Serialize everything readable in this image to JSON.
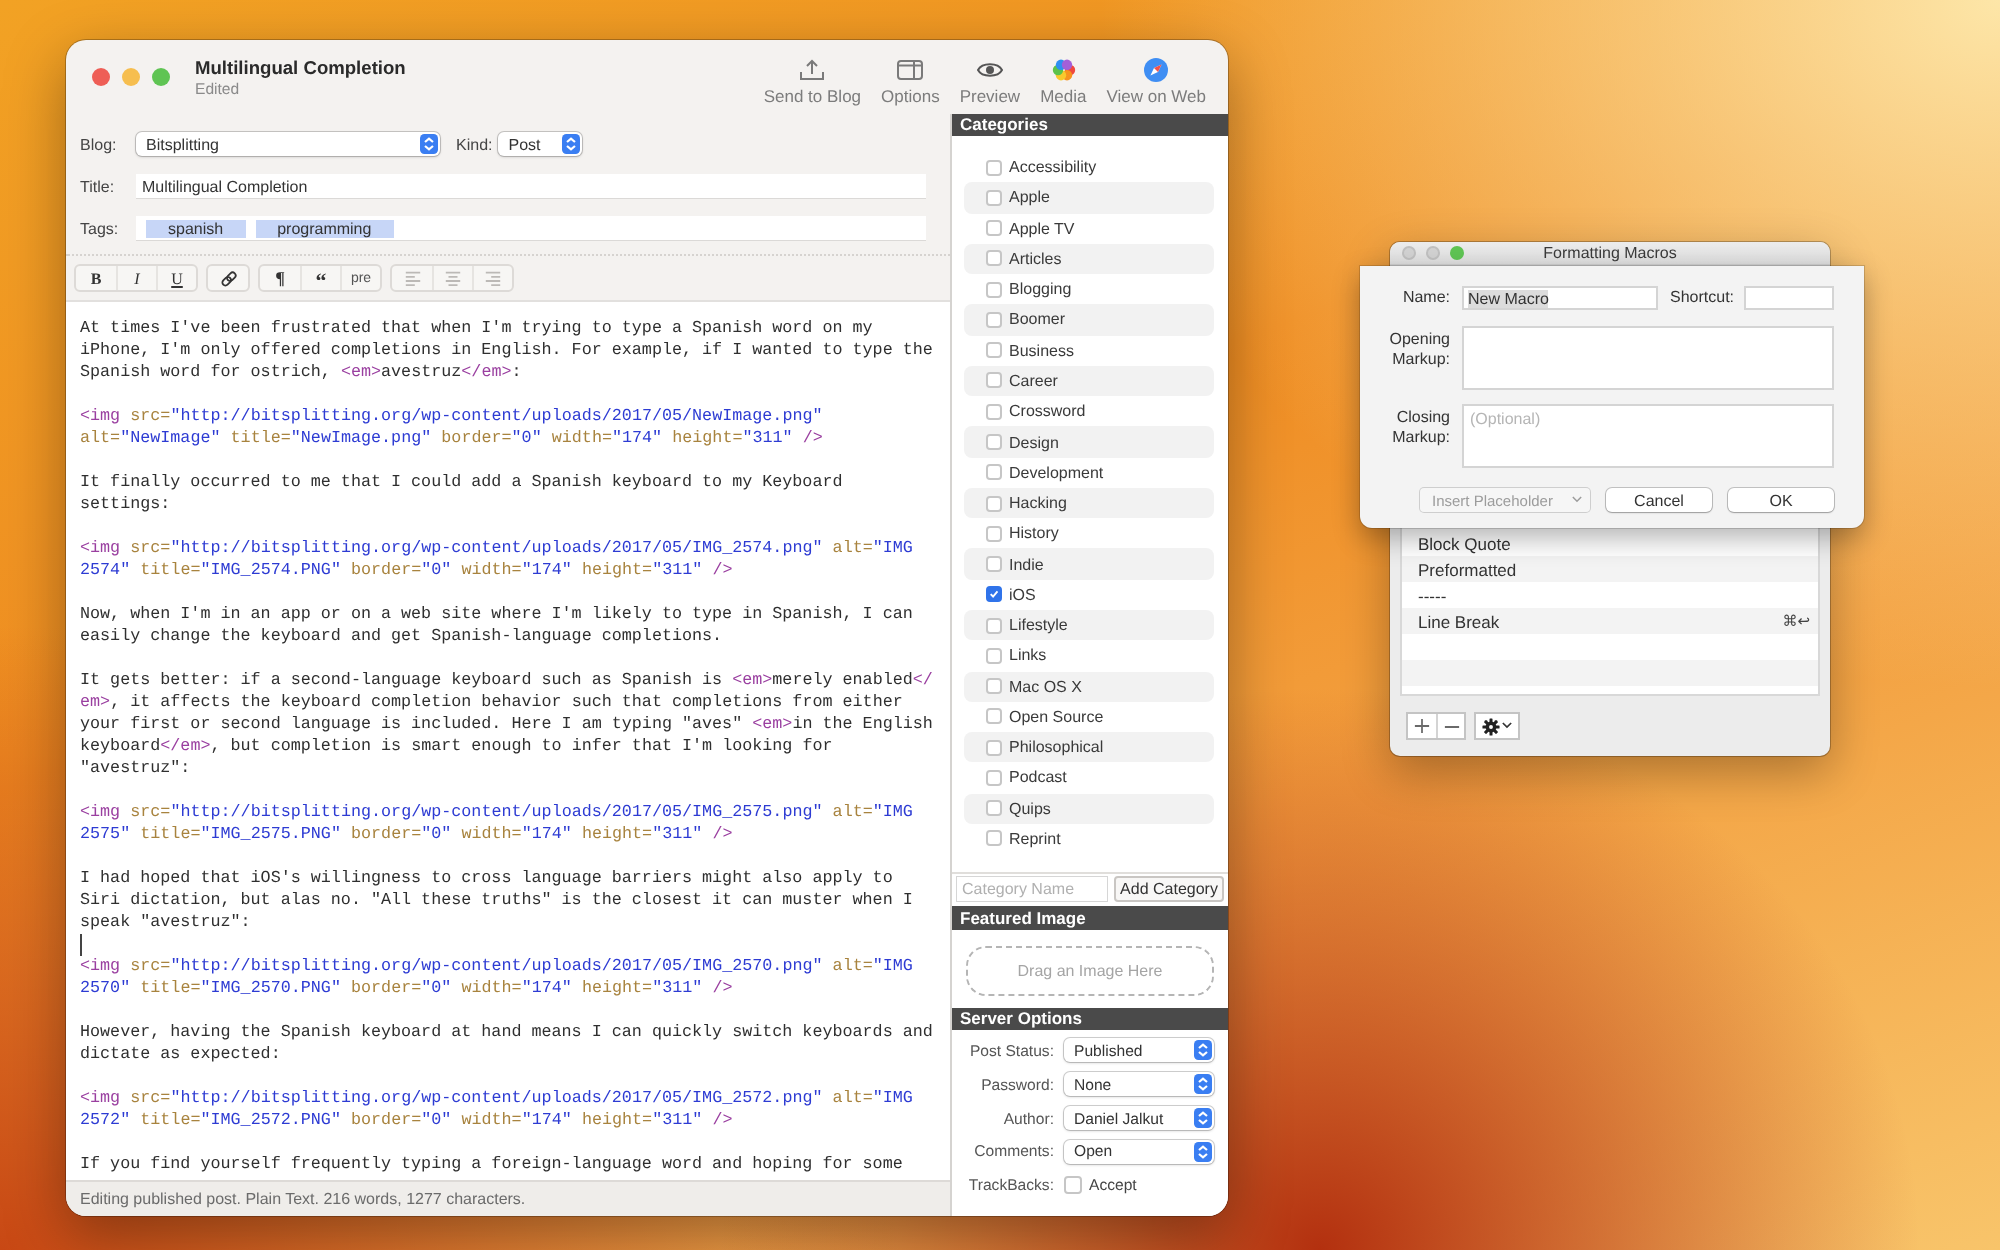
{
  "editor_window": {
    "traffic_lights": [
      {
        "disabled": false
      },
      {
        "disabled": false
      },
      {
        "disabled": false
      }
    ],
    "title": "Multilingual Completion",
    "subtitle": "Edited",
    "toolbar": [
      {
        "label": "Send to Blog"
      },
      {
        "label": "Options"
      },
      {
        "label": "Preview"
      },
      {
        "label": "Media"
      },
      {
        "label": "View on Web"
      }
    ],
    "form": {
      "blog": {
        "label": "Blog:",
        "value": "Bitsplitting"
      },
      "kind": {
        "label": "Kind:",
        "value": "Post"
      },
      "title": {
        "label": "Title:",
        "value": "Multilingual Completion"
      },
      "tags": {
        "label": "Tags:",
        "tokens": [
          "spanish",
          "programming"
        ]
      }
    },
    "format_bar": [
      {
        "buttons": [
          {
            "kind": "text",
            "label": "B",
            "disabled": false
          },
          {
            "kind": "text",
            "label": "I",
            "disabled": false
          },
          {
            "kind": "text",
            "label": "U",
            "disabled": false
          }
        ]
      },
      {
        "buttons": [
          {
            "kind": "icon",
            "disabled": false
          }
        ]
      },
      {
        "buttons": [
          {
            "kind": "text",
            "label": "¶",
            "disabled": false
          },
          {
            "kind": "text",
            "label": "“",
            "disabled": false
          },
          {
            "kind": "text",
            "label": "pre",
            "disabled": false
          }
        ]
      },
      {
        "buttons": [
          {
            "kind": "icon",
            "disabled": true
          },
          {
            "kind": "icon",
            "disabled": true
          },
          {
            "kind": "icon",
            "disabled": true
          }
        ]
      }
    ],
    "editor": {
      "paragraphs": [
        {
          "lines": [
            "At times I've been frustrated that when I'm trying to type a Spanish word on my",
            "iPhone, I'm only offered completions in English. For example, if I wanted to type the",
            "Spanish word for ostrich, <em>avestruz</em>:"
          ],
          "caret": false
        },
        {
          "lines": [
            "<img src=\"http://bitsplitting.org/wp-content/uploads/2017/05/NewImage.png\"",
            "alt=\"NewImage\" title=\"NewImage.png\" border=\"0\" width=\"174\" height=\"311\" />"
          ],
          "caret": false
        },
        {
          "lines": [
            "It finally occurred to me that I could add a Spanish keyboard to my Keyboard",
            "settings:"
          ],
          "caret": false
        },
        {
          "lines": [
            "<img src=\"http://bitsplitting.org/wp-content/uploads/2017/05/IMG_2574.png\" alt=\"IMG",
            "2574\" title=\"IMG_2574.PNG\" border=\"0\" width=\"174\" height=\"311\" />"
          ],
          "caret": false
        },
        {
          "lines": [
            "Now, when I'm in an app or on a web site where I'm likely to type in Spanish, I can",
            "easily change the keyboard and get Spanish-language completions."
          ],
          "caret": false
        },
        {
          "lines": [
            "It gets better: if a second-language keyboard such as Spanish is <em>merely enabled</",
            "em>, it affects the keyboard completion behavior such that completions from either",
            "your first or second language is included. Here I am typing \"aves\" <em>in the English",
            "keyboard</em>, but completion is smart enough to infer that I'm looking for",
            "\"avestruz\":"
          ],
          "caret": false
        },
        {
          "lines": [
            "<img src=\"http://bitsplitting.org/wp-content/uploads/2017/05/IMG_2575.png\" alt=\"IMG",
            "2575\" title=\"IMG_2575.PNG\" border=\"0\" width=\"174\" height=\"311\" />"
          ],
          "caret": false
        },
        {
          "lines": [
            "I had hoped that iOS's willingness to cross language barriers might also apply to",
            "Siri dictation, but alas no. \"All these truths\" is the closest it can muster when I",
            "speak \"avestruz\":"
          ],
          "caret": true
        },
        {
          "lines": [
            "<img src=\"http://bitsplitting.org/wp-content/uploads/2017/05/IMG_2570.png\" alt=\"IMG",
            "2570\" title=\"IMG_2570.PNG\" border=\"0\" width=\"174\" height=\"311\" />"
          ],
          "caret": false
        },
        {
          "lines": [
            "However, having the Spanish keyboard at hand means I can quickly switch keyboards and",
            "dictate as expected:"
          ],
          "caret": false
        },
        {
          "lines": [
            "<img src=\"http://bitsplitting.org/wp-content/uploads/2017/05/IMG_2572.png\" alt=\"IMG",
            "2572\" title=\"IMG_2572.PNG\" border=\"0\" width=\"174\" height=\"311\" />"
          ],
          "caret": false
        },
        {
          "lines": [
            "If you find yourself frequently typing a foreign-language word and hoping for some"
          ],
          "caret": false
        }
      ]
    },
    "status_bar": "Editing published post. Plain Text. 216 words, 1277 characters.",
    "categories": {
      "title": "Categories",
      "items": [
        {
          "label": "Accessibility",
          "checked": false
        },
        {
          "label": "Apple",
          "checked": false
        },
        {
          "label": "Apple TV",
          "checked": false
        },
        {
          "label": "Articles",
          "checked": false
        },
        {
          "label": "Blogging",
          "checked": false
        },
        {
          "label": "Boomer",
          "checked": false
        },
        {
          "label": "Business",
          "checked": false
        },
        {
          "label": "Career",
          "checked": false
        },
        {
          "label": "Crossword",
          "checked": false
        },
        {
          "label": "Design",
          "checked": false
        },
        {
          "label": "Development",
          "checked": false
        },
        {
          "label": "Hacking",
          "checked": false
        },
        {
          "label": "History",
          "checked": false
        },
        {
          "label": "Indie",
          "checked": false
        },
        {
          "label": "iOS",
          "checked": true
        },
        {
          "label": "Lifestyle",
          "checked": false
        },
        {
          "label": "Links",
          "checked": false
        },
        {
          "label": "Mac OS X",
          "checked": false
        },
        {
          "label": "Open Source",
          "checked": false
        },
        {
          "label": "Philosophical",
          "checked": false
        },
        {
          "label": "Podcast",
          "checked": false
        },
        {
          "label": "Quips",
          "checked": false
        },
        {
          "label": "Reprint",
          "checked": false
        }
      ],
      "new_category": {
        "placeholder": "Category Name"
      },
      "add_button": "Add Category"
    },
    "featured_image": {
      "title": "Featured Image",
      "drop_hint": "Drag an Image Here"
    },
    "server_options": {
      "title": "Server Options",
      "fields": [
        {
          "kind": "popup",
          "label": "Post Status:",
          "value": "Published"
        },
        {
          "kind": "popup",
          "label": "Password:",
          "value": "None"
        },
        {
          "kind": "popup",
          "label": "Author:",
          "value": "Daniel Jalkut"
        },
        {
          "kind": "popup",
          "label": "Comments:",
          "value": "Open"
        },
        {
          "kind": "checkbox",
          "label": "TrackBacks:",
          "option": "Accept",
          "checked": false
        }
      ]
    }
  },
  "macros_window": {
    "traffic_lights": [
      {
        "disabled": true
      },
      {
        "disabled": true
      },
      {
        "disabled": false
      }
    ],
    "title": "Formatting Macros",
    "macros": [
      {
        "name": "Block Quote"
      },
      {
        "name": "Preformatted"
      },
      {
        "name": "-----"
      },
      {
        "name": "Line Break",
        "shortcut": "⌘↩"
      }
    ],
    "sheet": {
      "name": {
        "label": "Name:",
        "value": "New Macro",
        "text_selected": true
      },
      "shortcut": {
        "label": "Shortcut:"
      },
      "opening": {
        "label": "Opening Markup:"
      },
      "closing": {
        "label": "Closing Markup:",
        "placeholder": "(Optional)"
      },
      "insert_placeholder": {
        "label": "Insert Placeholder",
        "disabled": true
      },
      "buttons": [
        "Cancel",
        "OK"
      ]
    }
  }
}
